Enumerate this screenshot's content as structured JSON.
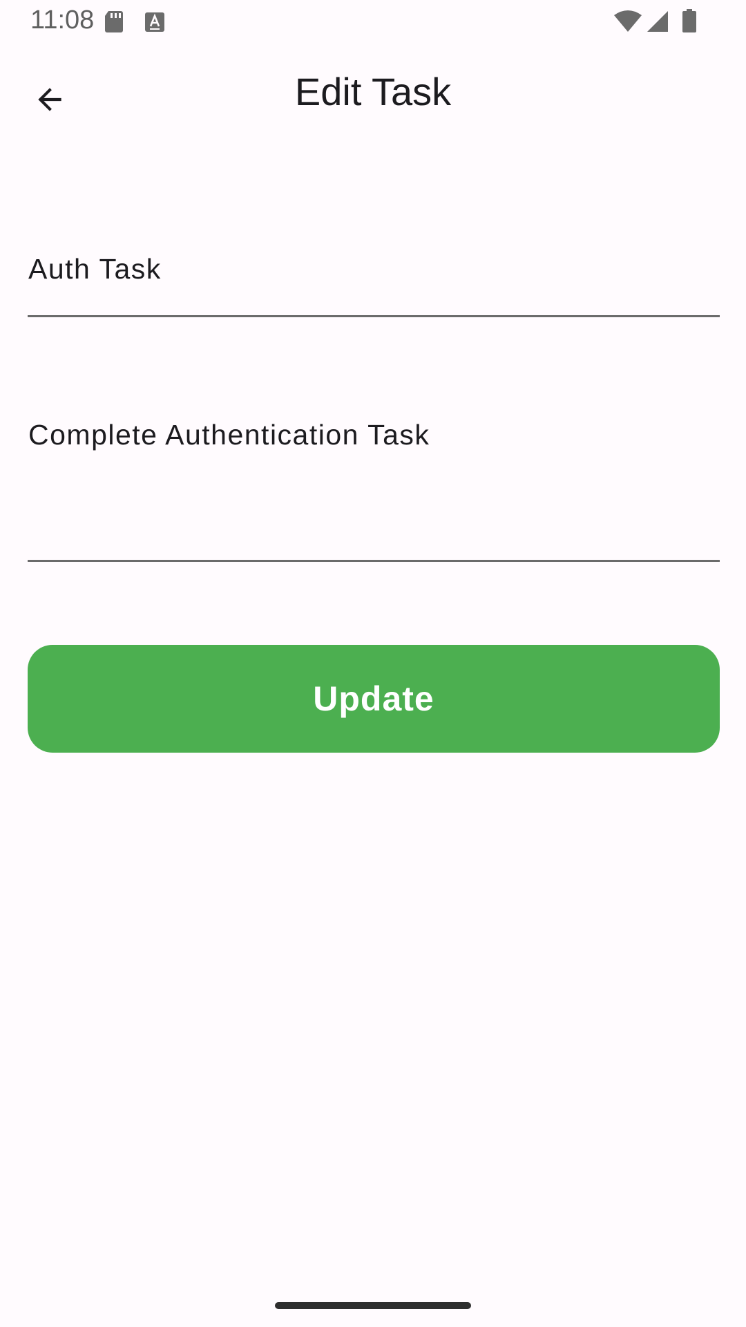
{
  "status_bar": {
    "time": "11:08",
    "icons": [
      "sd-card-icon",
      "text-a-icon",
      "wifi-icon",
      "cell-signal-icon",
      "battery-icon"
    ]
  },
  "app_bar": {
    "back_icon": "arrow-back-icon",
    "title": "Edit Task"
  },
  "form": {
    "title_field": {
      "value": "Auth Task"
    },
    "description_field": {
      "value": "Complete Authentication Task"
    },
    "update_button": {
      "label": "Update",
      "color": "#4caf50"
    }
  },
  "colors": {
    "background": "#fffbfe",
    "accent": "#4caf50",
    "text": "#1c1b1f",
    "underline": "#6b6b6b"
  }
}
